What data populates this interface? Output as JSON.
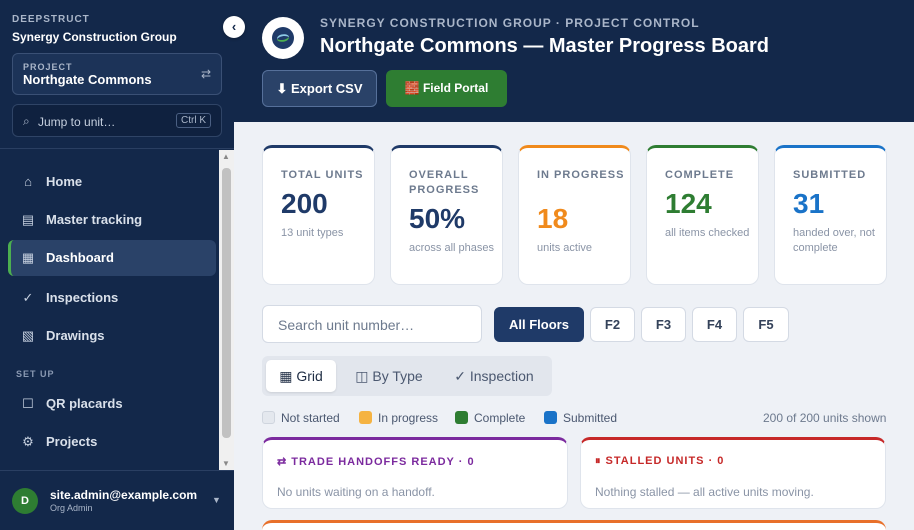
{
  "sidebar": {
    "brand": "DEEPSTRUCT",
    "org": "Synergy Construction Group",
    "project_label": "PROJECT",
    "project_name": "Northgate Commons",
    "jump_placeholder": "Jump to unit…",
    "jump_shortcut": "Ctrl K",
    "items": [
      {
        "label": "Home",
        "icon": "home-icon"
      },
      {
        "label": "Master tracking",
        "icon": "table-icon"
      },
      {
        "label": "Dashboard",
        "icon": "dashboard-icon",
        "active": true
      },
      {
        "label": "Inspections",
        "icon": "check-icon"
      },
      {
        "label": "Drawings",
        "icon": "drawing-icon"
      }
    ],
    "setup_label": "SET UP",
    "setup_items": [
      {
        "label": "QR placards",
        "icon": "qr-icon"
      },
      {
        "label": "Projects",
        "icon": "gear-icon"
      }
    ],
    "user": {
      "initial": "D",
      "email": "site.admin@example.com",
      "role": "Org Admin"
    }
  },
  "header": {
    "subtitle": "SYNERGY CONSTRUCTION GROUP · PROJECT CONTROL",
    "title": "Northgate Commons — Master Progress Board",
    "export_label": "⬇ Export CSV",
    "portal_label": "🧱 Field Portal"
  },
  "stats": [
    {
      "label": "TOTAL UNITS",
      "value": "200",
      "sub": "13 unit types",
      "color": "#1f3a68"
    },
    {
      "label": "OVERALL PROGRESS",
      "value": "50%",
      "sub": "across all phases",
      "color": "#1f3a68"
    },
    {
      "label": "IN PROGRESS",
      "value": "18",
      "sub": "units active",
      "color": "#f08a1c"
    },
    {
      "label": "COMPLETE",
      "value": "124",
      "sub": "all items checked",
      "color": "#2e7d32"
    },
    {
      "label": "SUBMITTED",
      "value": "31",
      "sub": "handed over, not complete",
      "color": "#1a73c8"
    }
  ],
  "filters": {
    "search_placeholder": "Search unit number…",
    "floors": [
      "All Floors",
      "F2",
      "F3",
      "F4",
      "F5"
    ],
    "active_floor": "All Floors"
  },
  "view_tabs": [
    "▦ Grid",
    "◫ By Type",
    "✓ Inspection"
  ],
  "active_view": "▦ Grid",
  "legend": [
    {
      "label": "Not started",
      "color": "#e4e8ee"
    },
    {
      "label": "In progress",
      "color": "#f5b342"
    },
    {
      "label": "Complete",
      "color": "#2e7d32"
    },
    {
      "label": "Submitted",
      "color": "#1a73c8"
    }
  ],
  "units_shown": "200 of 200 units shown",
  "panels": [
    {
      "title": "⇄ TRADE HANDOFFS READY · 0",
      "text": "No units waiting on a handoff.",
      "color": "#7b2a9e"
    },
    {
      "title": "⏸ STALLED UNITS · 0",
      "text": "Nothing stalled — all active units moving.",
      "color": "#c62828"
    }
  ]
}
